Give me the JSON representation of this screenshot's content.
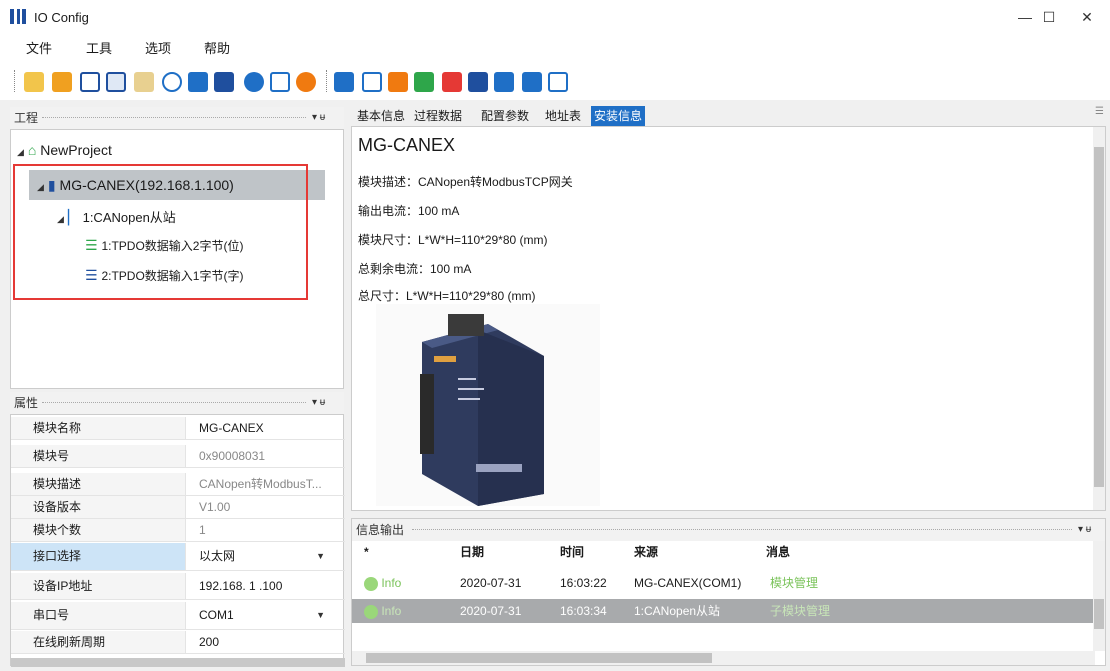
{
  "window": {
    "title": "IO Config",
    "minimize": "—",
    "maximize": "☐",
    "close": "✕"
  },
  "menu": [
    "文件",
    "工具",
    "选项",
    "帮助"
  ],
  "project_panel": {
    "title": "工程",
    "pin": "▾ ᵾ",
    "tree": {
      "root": "NewProject",
      "device": "MG-CANEX(192.168.1.100)",
      "slave": "1:CANopen从站",
      "pdo1": "1:TPDO数据输入2字节(位)",
      "pdo2": "2:TPDO数据输入1字节(字)"
    }
  },
  "properties": {
    "title": "属性",
    "rows": [
      {
        "key": "模块名称",
        "value": "MG-CANEX"
      },
      {
        "key": "模块号",
        "value": "0x90008031"
      },
      {
        "key": "模块描述",
        "value": "CANopen转ModbusT..."
      },
      {
        "key": "设备版本",
        "value": "V1.00"
      },
      {
        "key": "模块个数",
        "value": "1"
      },
      {
        "key": "接口选择",
        "value": "以太网"
      },
      {
        "key": "设备IP地址",
        "value": "192.168.  1  .100"
      },
      {
        "key": "串口号",
        "value": "COM1"
      },
      {
        "key": "在线刷新周期",
        "value": "200"
      }
    ]
  },
  "tabs": [
    "基本信息",
    "过程数据",
    "配置参数",
    "地址表",
    "安装信息"
  ],
  "detail": {
    "title": "MG-CANEX",
    "lines": [
      "模块描述：CANopen转ModbusTCP网关",
      "输出电流：100 mA",
      "模块尺寸：L*W*H=110*29*80 (mm)",
      "总剩余电流：100 mA",
      "总尺寸：L*W*H=110*29*80 (mm)"
    ]
  },
  "messages": {
    "title": "信息输出",
    "columns": [
      "*",
      "日期",
      "时间",
      "来源",
      "消息"
    ],
    "rows": [
      {
        "level": "Info",
        "date": "2020-07-31",
        "time": "16:03:22",
        "source": "MG-CANEX(COM1)",
        "message": "模块管理"
      },
      {
        "level": "Info",
        "date": "2020-07-31",
        "time": "16:03:34",
        "source": "1:CANopen从站",
        "message": "子模块管理"
      }
    ]
  },
  "colors": {
    "selection": "#1f6fc6",
    "highlight_box": "#e53935",
    "info_green": "#7ac35a"
  }
}
